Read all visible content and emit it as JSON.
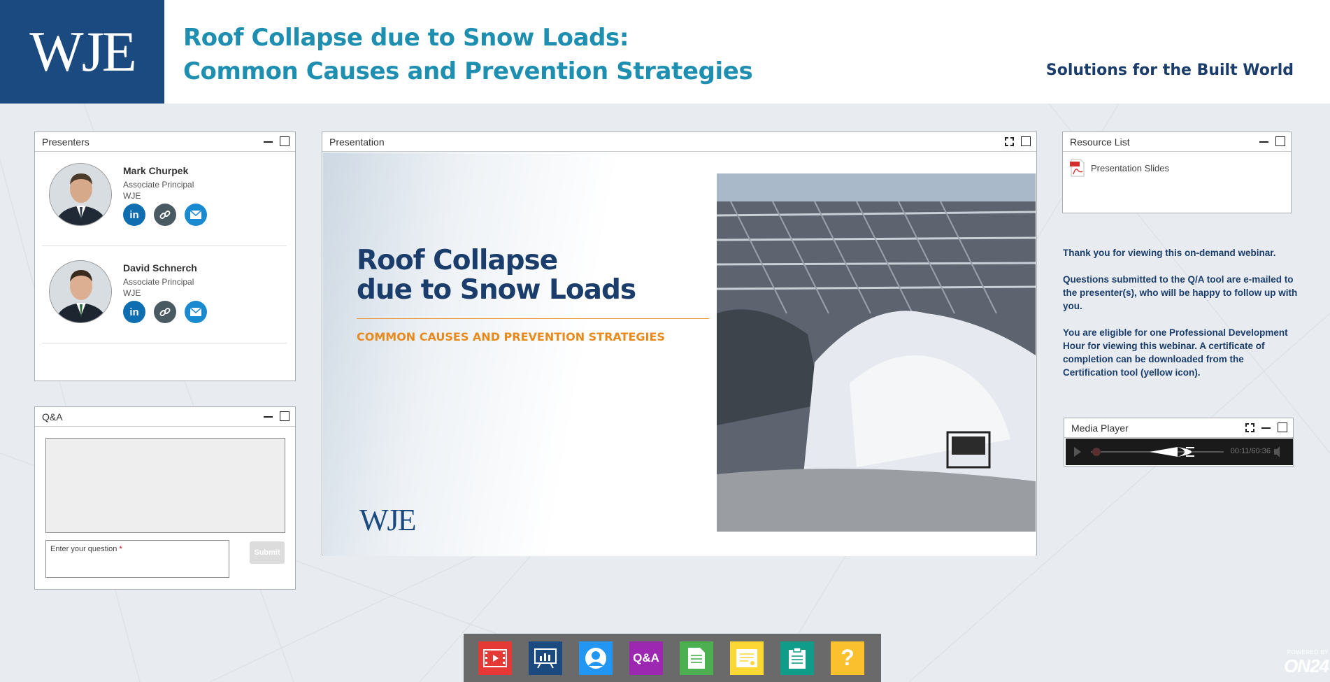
{
  "header": {
    "logo": "WJE",
    "title_line1": "Roof Collapse due to Snow Loads:",
    "title_line2": "Common Causes and Prevention Strategies",
    "tagline": "Solutions for the Built World"
  },
  "presenters": {
    "title": "Presenters",
    "people": [
      {
        "name": "Mark Churpek",
        "role": "Associate Principal",
        "org": "WJE"
      },
      {
        "name": "David Schnerch",
        "role": "Associate Principal",
        "org": "WJE"
      }
    ],
    "icon_labels": {
      "linkedin": "in"
    }
  },
  "qa": {
    "title": "Q&A",
    "input_label": "Enter your question",
    "required_mark": "*",
    "submit_label": "Submit"
  },
  "presentation": {
    "title": "Presentation",
    "slide_title_line1": "Roof Collapse",
    "slide_title_line2": "due to Snow Loads",
    "slide_subtitle": "COMMON CAUSES AND PREVENTION STRATEGIES",
    "slide_logo": "WJE"
  },
  "resources": {
    "title": "Resource List",
    "items": [
      {
        "label": "Presentation Slides",
        "icon": "pdf-icon"
      }
    ]
  },
  "notes": {
    "p1": "Thank you for viewing this on-demand webinar.",
    "p2": "Questions submitted to the Q/A tool are e-mailed to the presenter(s), who will be happy to follow up with you.",
    "p3": "You are eligible for one Professional Development Hour for viewing this webinar. A certificate of completion can be downloaded from the Certification tool (yellow icon)."
  },
  "media_player": {
    "title": "Media Player",
    "time": "00:11/60:36",
    "progress_fraction": 0.003
  },
  "toolbar": {
    "items": [
      {
        "name": "media-player",
        "icon": "film-icon",
        "color": "#e53935"
      },
      {
        "name": "slides",
        "icon": "presentation-icon",
        "color": "#1a4a80"
      },
      {
        "name": "presenters",
        "icon": "person-icon",
        "color": "#2196f3"
      },
      {
        "name": "qa",
        "icon": "qa-icon",
        "label": "Q&A",
        "color": "#9c27b0"
      },
      {
        "name": "resources",
        "icon": "document-icon",
        "color": "#4caf50"
      },
      {
        "name": "certificate",
        "icon": "certificate-icon",
        "color": "#fdd835"
      },
      {
        "name": "survey",
        "icon": "clipboard-icon",
        "color": "#0f9d8a"
      },
      {
        "name": "help",
        "icon": "question-icon",
        "label": "?",
        "color": "#fbc02d"
      }
    ]
  },
  "powered_by": {
    "line1": "POWERED BY",
    "brand": "ON24"
  }
}
